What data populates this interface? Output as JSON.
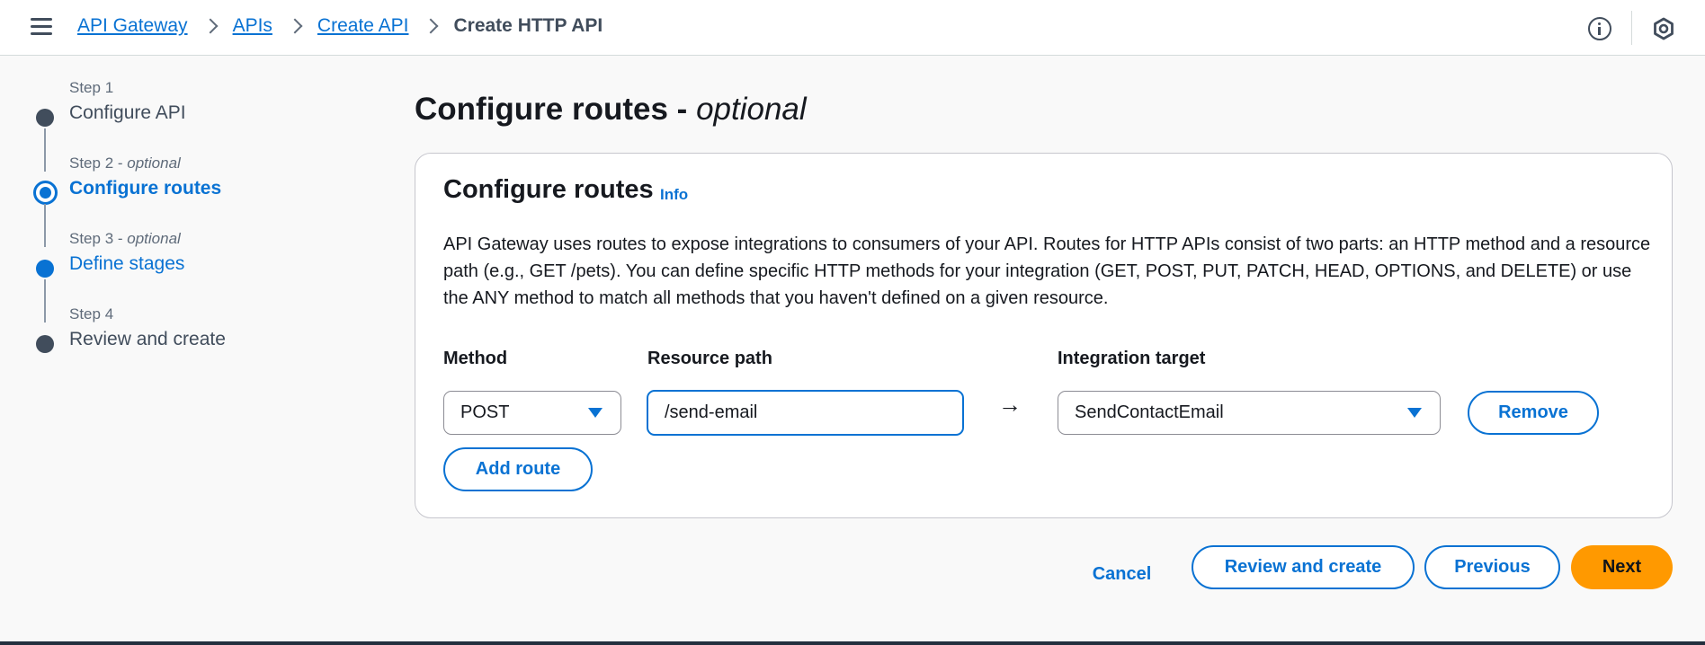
{
  "breadcrumb": {
    "items": [
      "API Gateway",
      "APIs",
      "Create API"
    ],
    "current": "Create HTTP API"
  },
  "icons": {
    "menu": "hamburger-menu-icon",
    "info": "info-circle-icon",
    "settings": "hexagon-settings-icon"
  },
  "steps": [
    {
      "small": "Step 1",
      "optional": "",
      "label": "Configure API",
      "state": "completed"
    },
    {
      "small": "Step 2 - ",
      "optional": "optional",
      "label": "Configure routes",
      "state": "current"
    },
    {
      "small": "Step 3 - ",
      "optional": "optional",
      "label": "Define stages",
      "state": "link"
    },
    {
      "small": "Step 4",
      "optional": "",
      "label": "Review and create",
      "state": "pending"
    }
  ],
  "page": {
    "title": "Configure routes - ",
    "title_optional": "optional"
  },
  "panel": {
    "title": "Configure routes",
    "info_link": "Info",
    "description": "API Gateway uses routes to expose integrations to consumers of your API. Routes for HTTP APIs consist of two parts: an HTTP method and a resource path (e.g., GET /pets). You can define specific HTTP methods for your integration (GET, POST, PUT, PATCH, HEAD, OPTIONS, and DELETE) or use the ANY method to match all methods that you haven't defined on a given resource.",
    "labels": {
      "method": "Method",
      "resource_path": "Resource path",
      "integration_target": "Integration target"
    },
    "route": {
      "method": "POST",
      "resource_path": "/send-email",
      "arrow": "→",
      "integration_target": "SendContactEmail",
      "remove_label": "Remove"
    },
    "add_route_label": "Add route"
  },
  "actions": {
    "cancel": "Cancel",
    "review_and_create": "Review and create",
    "previous": "Previous",
    "next": "Next"
  },
  "colors": {
    "accent": "#0972d3",
    "primary_button": "#ff9900",
    "text": "#16191f"
  }
}
